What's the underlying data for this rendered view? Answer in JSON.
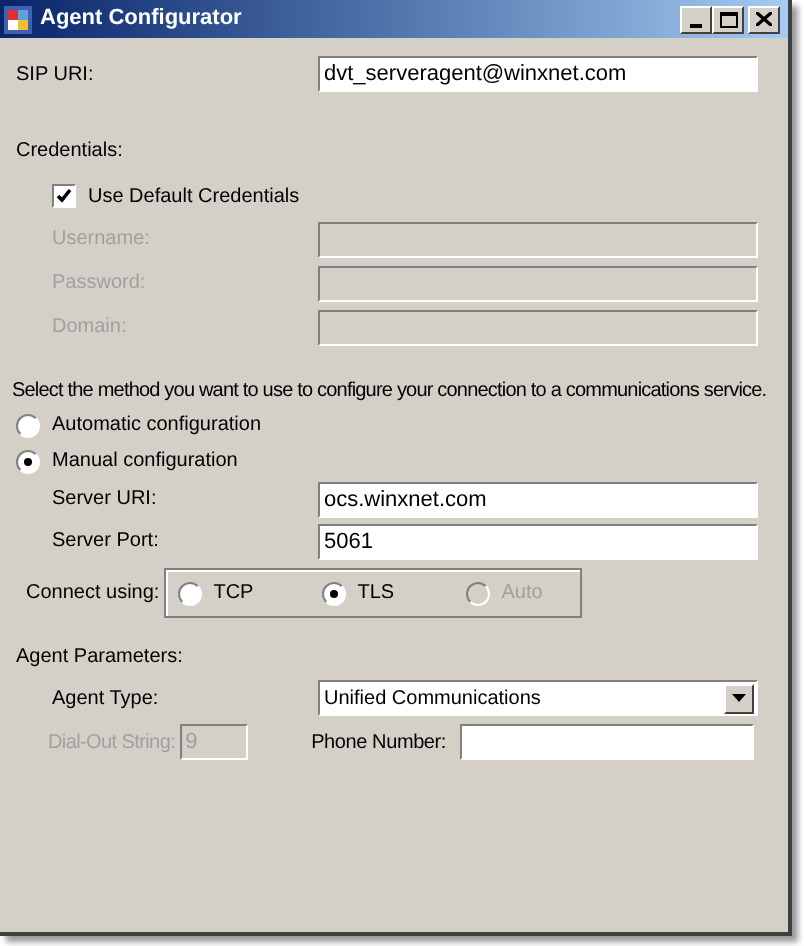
{
  "window": {
    "title": "Agent Configurator"
  },
  "sip_uri": {
    "label": "SIP URI:",
    "value": "dvt_serveragent@winxnet.com"
  },
  "credentials": {
    "heading": "Credentials:",
    "use_default": {
      "label": "Use Default Credentials",
      "checked": true
    },
    "fields": [
      {
        "label": "Username:",
        "disabled": true
      },
      {
        "label": "Password:",
        "disabled": true
      },
      {
        "label": "Domain:",
        "disabled": true
      }
    ]
  },
  "method": {
    "prompt": "Select the method you want to use to configure your connection to a communications service.",
    "options": [
      {
        "label": "Automatic configuration",
        "selected": false
      },
      {
        "label": "Manual configuration",
        "selected": true
      }
    ]
  },
  "server_fields": [
    {
      "label": "Server URI:",
      "value": "ocs.winxnet.com"
    },
    {
      "label": "Server Port:",
      "value": "5061"
    }
  ],
  "connect_using": {
    "label": "Connect using:",
    "options": [
      {
        "label": "TCP",
        "selected": false,
        "disabled": false
      },
      {
        "label": "TLS",
        "selected": true,
        "disabled": false
      },
      {
        "label": "Auto",
        "selected": false,
        "disabled": true
      }
    ]
  },
  "agent_parameters": {
    "heading": "Agent Parameters:",
    "agent_type": {
      "label": "Agent Type:",
      "value": "Unified Communications"
    },
    "dial_out": {
      "label": "Dial-Out String:",
      "value": "9",
      "disabled": true
    },
    "phone_number": {
      "label": "Phone Number:"
    }
  }
}
